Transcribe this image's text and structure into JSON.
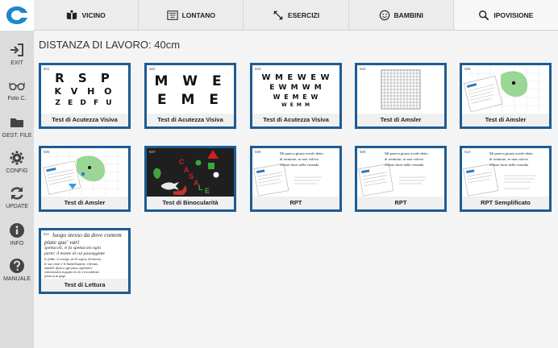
{
  "nav": {
    "tabs": [
      {
        "label": "VICINO",
        "icon": "book-icon"
      },
      {
        "label": "LONTANO",
        "icon": "chart-icon"
      },
      {
        "label": "ESERCIZI",
        "icon": "arrows-diagonal-icon"
      },
      {
        "label": "BAMBINI",
        "icon": "smiley-icon"
      },
      {
        "label": "IPOVISIONE",
        "icon": "search-icon"
      }
    ]
  },
  "sidebar": {
    "items": [
      {
        "label": "EXIT",
        "icon": "exit-icon"
      },
      {
        "label": "Foto C.",
        "icon": "glasses-icon"
      },
      {
        "label": "GEST. FILE",
        "icon": "folder-icon"
      },
      {
        "label": "CONFIG",
        "icon": "gear-icon"
      },
      {
        "label": "UPDATE",
        "icon": "refresh-icon"
      },
      {
        "label": "INFO",
        "icon": "info-icon"
      },
      {
        "label": "MANUALE",
        "icon": "help-icon"
      }
    ]
  },
  "main": {
    "title": "DISTANZA DI LAVORO: 40cm"
  },
  "tests": [
    {
      "num": "501",
      "label": "Test di Acutezza Visiva",
      "lines": [
        "R S P",
        "K V H O",
        "Z E D F U"
      ]
    },
    {
      "num": "502",
      "label": "Test di Acutezza Visiva",
      "lines": [
        "M W E",
        "E M E"
      ]
    },
    {
      "num": "503",
      "label": "Test di Acutezza Visiva",
      "lines": [
        "W M E W E W",
        "E W M W M",
        "W E M E W",
        "W E M M"
      ]
    },
    {
      "num": "504",
      "label": "Test di Amsler"
    },
    {
      "num": "505",
      "label": "Test di Amsler"
    },
    {
      "num": "506",
      "label": "Test di Amsler"
    },
    {
      "num": "507",
      "label": "Test di Binocularità",
      "letters": [
        "C",
        "A",
        "S",
        "A",
        "L",
        "E"
      ]
    },
    {
      "num": "508",
      "label": "RPT",
      "lines": [
        "Mi pareva giusto averle detto",
        "di rientrare, se non voleva",
        "restare fuori nella veranda"
      ]
    },
    {
      "num": "509",
      "label": "RPT",
      "lines": [
        "Mi pareva giusto averle detto",
        "di rientrare, se non voleva",
        "restare fuori nella veranda"
      ]
    },
    {
      "num": "510",
      "label": "RPT Semplificato",
      "lines": [
        "Mi pareva giusto averle detto",
        "di rientrare, se non voleva",
        "restare fuori nella veranda"
      ]
    },
    {
      "num": "511",
      "label": "Test di Lettura",
      "lines": [
        "luogo stesso da dove contem",
        "piate que' vari",
        "spettacoli, vi fa spettacolo ogni",
        "parte: il monte di cui passeggiate",
        "le falde, vi svolge, al di sopra, d'intorno,",
        "le sue cime e le balzelluzzine, rilevate,",
        "mutabili. Quasi a ogni passo, apprendere",
        "contornandosi in guglia ciò che v'era sembrato",
        "prima su un giogo"
      ]
    }
  ]
}
